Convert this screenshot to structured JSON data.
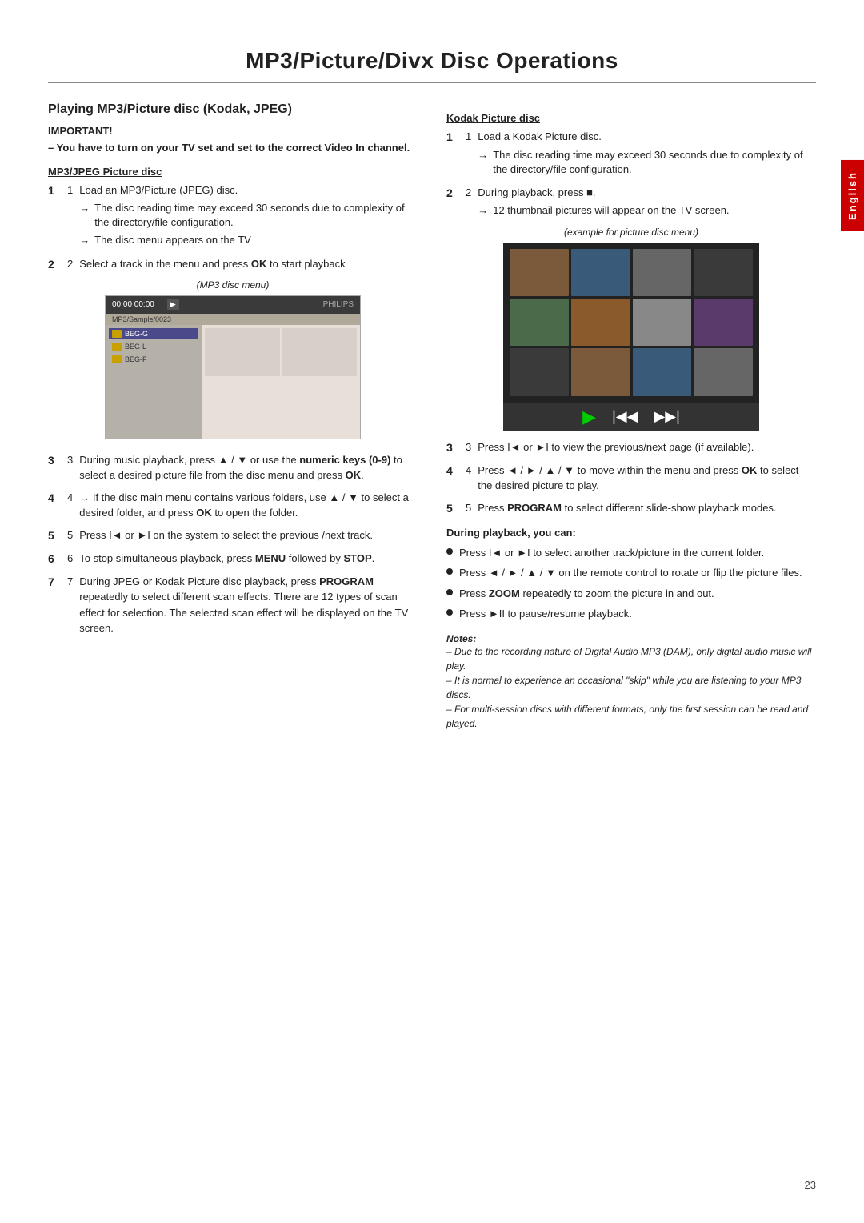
{
  "page": {
    "title": "MP3/Picture/Divx Disc Operations",
    "page_number": "23",
    "tab_label": "English"
  },
  "left_section": {
    "heading": "Playing MP3/Picture disc (Kodak, JPEG)",
    "important": {
      "label": "IMPORTANT!",
      "lines": [
        "– You have to turn on your TV set and set to the correct Video In channel."
      ]
    },
    "mp3_jpeg_heading": "MP3/JPEG Picture disc",
    "mp3_caption": "(MP3 disc menu)",
    "steps": [
      {
        "number": "1",
        "text": "Load an MP3/Picture (JPEG) disc.",
        "arrows": [
          "The disc reading time may exceed 30 seconds due to complexity of the directory/file configuration.",
          "The disc menu appears on the TV"
        ]
      },
      {
        "number": "2",
        "text": "Select a track in the menu and press OK to start playback",
        "arrows": []
      },
      {
        "number": "3",
        "text": "During music playback, press ▲ / ▼ or use the numeric keys (0-9) to select a desired picture file from the disc menu and press OK.",
        "arrows": []
      },
      {
        "number": "4",
        "text": "→ If the disc main menu contains various folders, use ▲ / ▼ to select a desired folder, and press OK to open the folder.",
        "arrows": []
      },
      {
        "number": "5",
        "text": "Press I◄ or ►I on the system to select the previous /next track.",
        "arrows": []
      },
      {
        "number": "6",
        "text": "To stop simultaneous playback, press MENU followed by STOP.",
        "arrows": []
      },
      {
        "number": "7",
        "text": "During JPEG or Kodak Picture disc playback, press PROGRAM repeatedly to select different scan effects. There are 12 types of scan effect for selection. The selected scan effect will be displayed on the TV screen.",
        "arrows": []
      }
    ]
  },
  "right_section": {
    "kodak_heading": "Kodak Picture disc",
    "kodak_steps": [
      {
        "number": "1",
        "text": "Load a Kodak Picture disc.",
        "arrows": [
          "The disc reading time may exceed 30 seconds due to complexity of the directory/file configuration."
        ]
      },
      {
        "number": "2",
        "text": "During playback, press ■.",
        "arrows": [
          "12 thumbnail pictures will appear on the TV screen."
        ]
      },
      {
        "number": "3",
        "text": "Press I◄ or ►I to view the previous/next page (if available).",
        "arrows": []
      },
      {
        "number": "4",
        "text": "Press ◄ / ► / ▲ / ▼ to move within the menu and press OK to select the desired picture to play.",
        "arrows": []
      },
      {
        "number": "5",
        "text": "Press PROGRAM to select different slide-show playback modes.",
        "arrows": []
      }
    ],
    "pic_caption": "(example for picture disc menu)",
    "during_playback_heading": "During playback, you can:",
    "during_playback_bullets": [
      "Press I◄ or ►I to select another track/picture in the current folder.",
      "Press ◄ / ► / ▲ / ▼ on the remote control to rotate or flip the picture files.",
      "Press ZOOM repeatedly to zoom the picture in and out.",
      "Press ►II to pause/resume playback."
    ],
    "notes": {
      "label": "Notes:",
      "items": [
        "– Due to the recording nature of Digital Audio MP3 (DAM), only digital audio music will play.",
        "– It is normal to experience an occasional \"skip\" while you are listening to your MP3 discs.",
        "– For multi-session discs with different formats, only the first session can be read and played."
      ]
    }
  }
}
